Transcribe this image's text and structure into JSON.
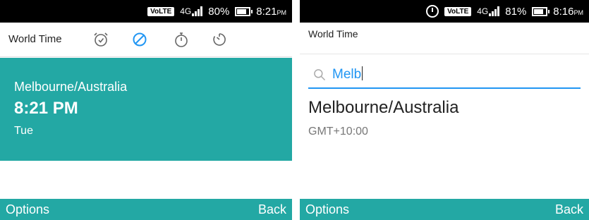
{
  "left": {
    "status": {
      "network": "VoLTE",
      "signal": "4G",
      "battery": "80%",
      "time": "8:21",
      "time_suffix": "PM"
    },
    "title": "World Time",
    "tabs": [
      {
        "icon": "alarm-icon"
      },
      {
        "icon": "world-clock-icon",
        "active": true
      },
      {
        "icon": "stopwatch-icon"
      },
      {
        "icon": "timer-icon"
      }
    ],
    "card": {
      "city": "Melbourne/Australia",
      "time": "8:21 PM",
      "day": "Tue"
    },
    "softkeys": {
      "left": "Options",
      "right": "Back"
    }
  },
  "right": {
    "status": {
      "network": "VoLTE",
      "signal": "4G",
      "battery": "81%",
      "time": "8:16",
      "time_suffix": "PM"
    },
    "title": "World Time",
    "search": {
      "query": "Melb"
    },
    "result": {
      "city": "Melbourne/Australia",
      "offset": "GMT+10:00"
    },
    "softkeys": {
      "left": "Options",
      "right": "Back"
    }
  },
  "colors": {
    "accent": "#23a8a4",
    "highlight": "#2196f3"
  }
}
